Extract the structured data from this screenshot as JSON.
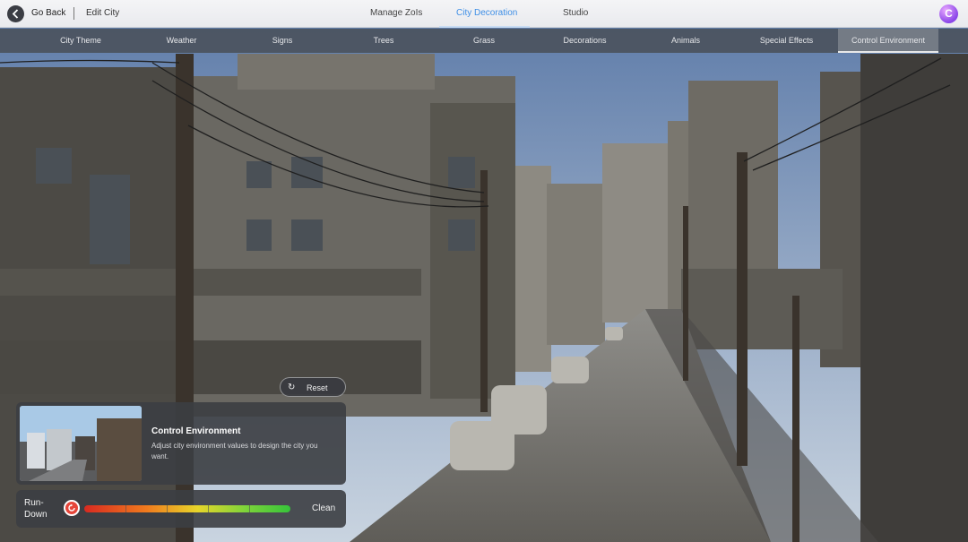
{
  "header": {
    "back_label": "Go Back",
    "edit_label": "Edit City",
    "tabs": [
      {
        "label": "Manage ZoIs"
      },
      {
        "label": "City Decoration"
      },
      {
        "label": "Studio"
      }
    ],
    "active_tab": "City Decoration",
    "avatar_letter": "C"
  },
  "subnav": {
    "items": [
      {
        "label": "City Theme"
      },
      {
        "label": "Weather"
      },
      {
        "label": "Signs"
      },
      {
        "label": "Trees"
      },
      {
        "label": "Grass"
      },
      {
        "label": "Decorations"
      },
      {
        "label": "Animals"
      },
      {
        "label": "Special Effects"
      },
      {
        "label": "Control Environment"
      }
    ],
    "active_item": "Control Environment"
  },
  "panel": {
    "reset_label": "Reset",
    "title": "Control Environment",
    "description": "Adjust city environment values to design the city you want."
  },
  "environment_slider": {
    "left_label": "Run-Down",
    "right_label": "Clean",
    "value_fraction": 0.0
  },
  "colors": {
    "accent": "#3f8fe6",
    "slider_red": "#d82a20",
    "slider_green": "#36c43a"
  }
}
